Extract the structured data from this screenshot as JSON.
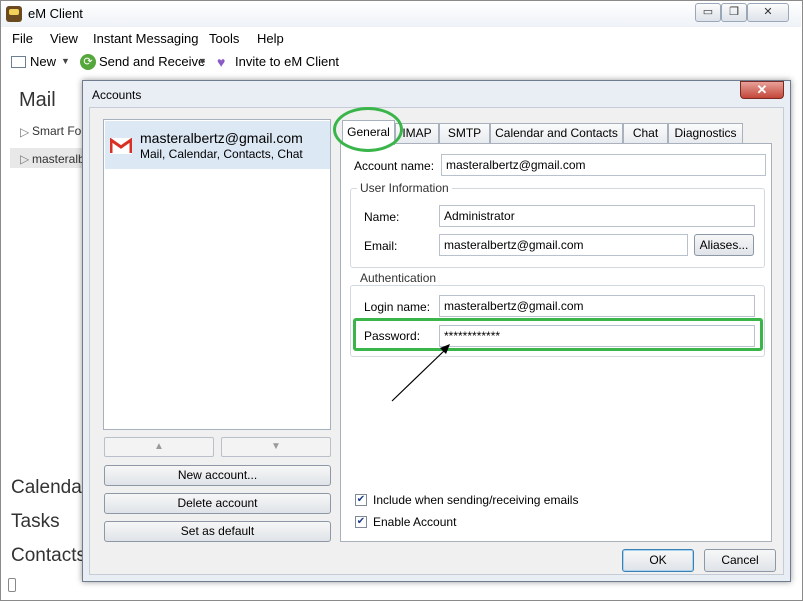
{
  "window": {
    "title": "eM Client",
    "min_glyph": "▭",
    "restore_glyph": "❐",
    "close_glyph": "✕"
  },
  "menu": [
    "File",
    "View",
    "Instant Messaging",
    "Tools",
    "Help"
  ],
  "toolbar": {
    "new_label": "New",
    "send_receive_label": "Send and Receive",
    "invite_label": "Invite to eM Client"
  },
  "sidebar": {
    "heading": "Mail",
    "tree": [
      {
        "label": "Smart Fol"
      },
      {
        "label": "masteralb"
      }
    ],
    "nav": [
      "Calendar",
      "Tasks",
      "Contacts"
    ]
  },
  "dialog": {
    "title": "Accounts",
    "close_glyph": "✕",
    "account": {
      "email": "masteralbertz@gmail.com",
      "services": "Mail, Calendar, Contacts, Chat"
    },
    "buttons": {
      "new_account": "New account...",
      "delete_account": "Delete account",
      "set_default": "Set as default",
      "ok": "OK",
      "cancel": "Cancel"
    },
    "tabs": [
      "General",
      "IMAP",
      "SMTP",
      "Calendar and Contacts",
      "Chat",
      "Diagnostics"
    ],
    "general": {
      "account_name_label": "Account name:",
      "account_name": "masteralbertz@gmail.com",
      "user_info_title": "User Information",
      "name_label": "Name:",
      "name": "Administrator",
      "email_label": "Email:",
      "email": "masteralbertz@gmail.com",
      "aliases_button": "Aliases...",
      "auth_title": "Authentication",
      "login_label": "Login name:",
      "login": "masteralbertz@gmail.com",
      "password_label": "Password:",
      "password": "************",
      "include_label": "Include when sending/receiving emails",
      "include_checked": true,
      "enable_label": "Enable Account",
      "enable_checked": true
    }
  },
  "colors": {
    "highlight": "#3ab54a",
    "selection": "#dde8f5"
  }
}
